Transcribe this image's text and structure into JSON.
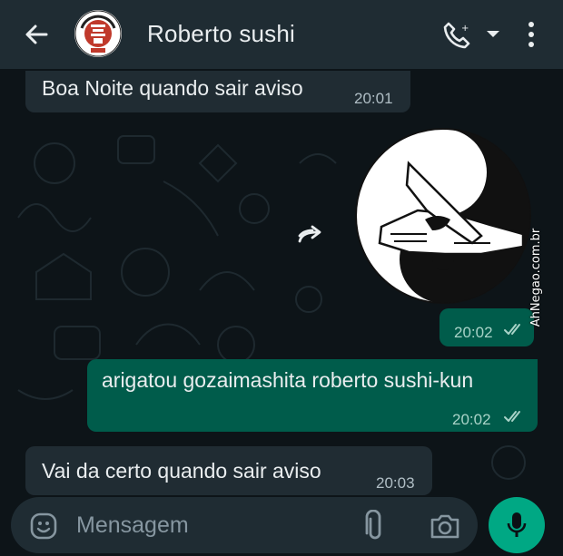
{
  "header": {
    "title": "Roberto sushi",
    "avatar_text": "ROBERTO SUSHI"
  },
  "messages": [
    {
      "direction": "incoming",
      "text": "Boa Noite quando sair aviso",
      "time": "20:01"
    },
    {
      "direction": "outgoing",
      "type": "sticker",
      "time": "20:02",
      "status": "read"
    },
    {
      "direction": "outgoing",
      "text": "arigatou gozaimashita roberto sushi-kun",
      "time": "20:02",
      "status": "read"
    },
    {
      "direction": "incoming",
      "text": "Vai da certo quando sair aviso",
      "time": "20:03"
    }
  ],
  "composer": {
    "placeholder": "Mensagem"
  },
  "watermark": "AhNegao.com.br",
  "icons": [
    "back-arrow-icon",
    "phone-icon",
    "chevron-down-icon",
    "more-vert-icon",
    "forward-icon",
    "emoji-icon",
    "paperclip-icon",
    "camera-icon",
    "microphone-icon",
    "double-check-icon"
  ],
  "colors": {
    "header_bg": "#1f2c33",
    "chat_bg": "#0d1418",
    "incoming_bubble": "#202c33",
    "outgoing_bubble": "#005c4b",
    "accent": "#00a884"
  }
}
